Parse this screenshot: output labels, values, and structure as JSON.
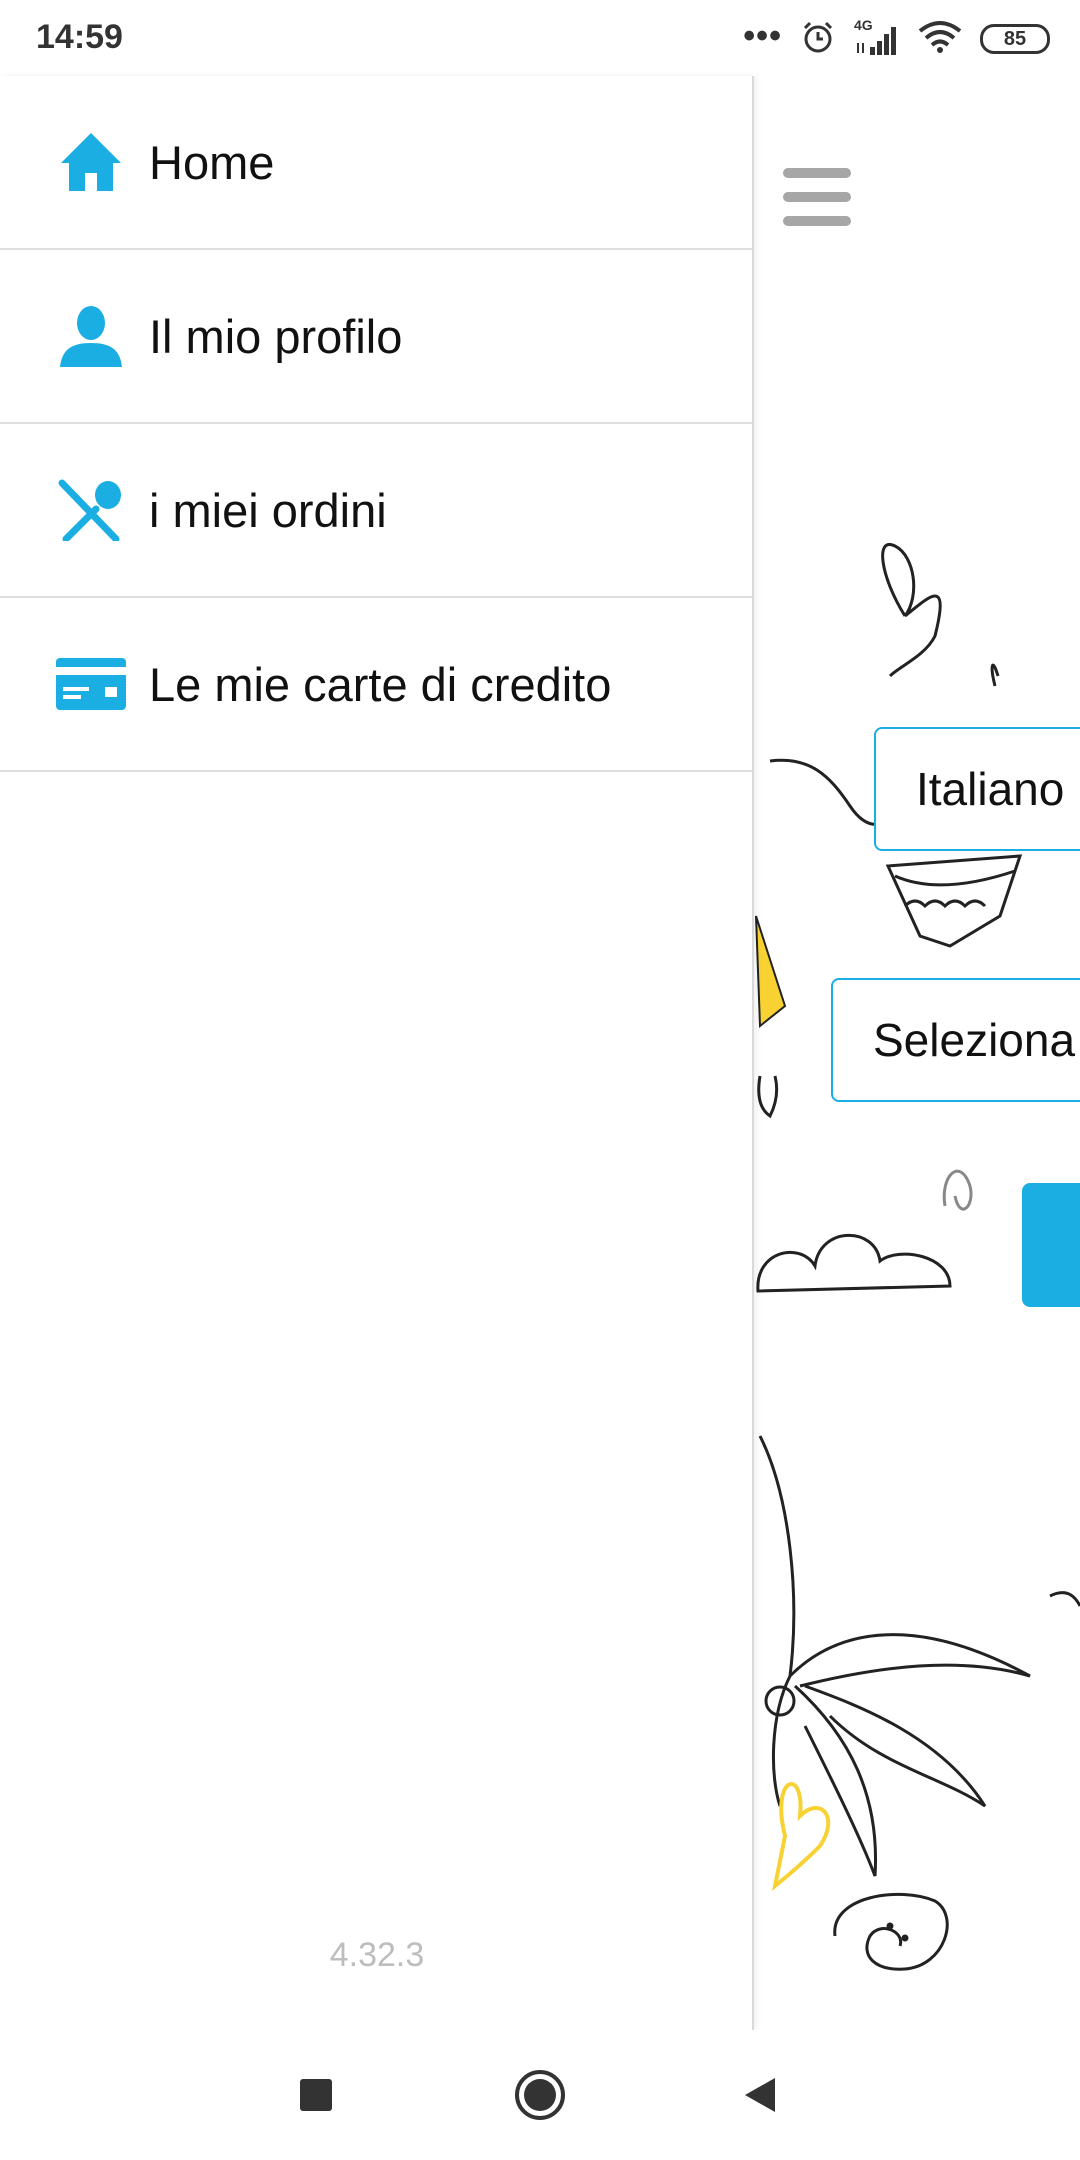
{
  "status_bar": {
    "time": "14:59",
    "network": "4G",
    "battery": "85",
    "icons": [
      "more-dots-icon",
      "alarm-icon",
      "signal-icon",
      "wifi-icon",
      "battery-icon"
    ]
  },
  "drawer": {
    "items": [
      {
        "label": "Home",
        "icon": "home-icon"
      },
      {
        "label": "Il mio profilo",
        "icon": "profile-icon"
      },
      {
        "label": "i miei ordini",
        "icon": "cutlery-icon"
      },
      {
        "label": "Le mie carte di credito",
        "icon": "credit-card-icon"
      }
    ],
    "version": "4.32.3"
  },
  "main": {
    "language_select": "Italiano",
    "place_select": "Seleziona",
    "menu_icon": "hamburger-icon"
  },
  "nav_bar": {
    "icons": [
      "recent-apps-icon",
      "home-circle-icon",
      "back-icon"
    ]
  },
  "colors": {
    "accent": "#1baee3",
    "divider": "#dedede",
    "version_text": "#bdbdbd",
    "hamburger": "#a6a6a6"
  }
}
